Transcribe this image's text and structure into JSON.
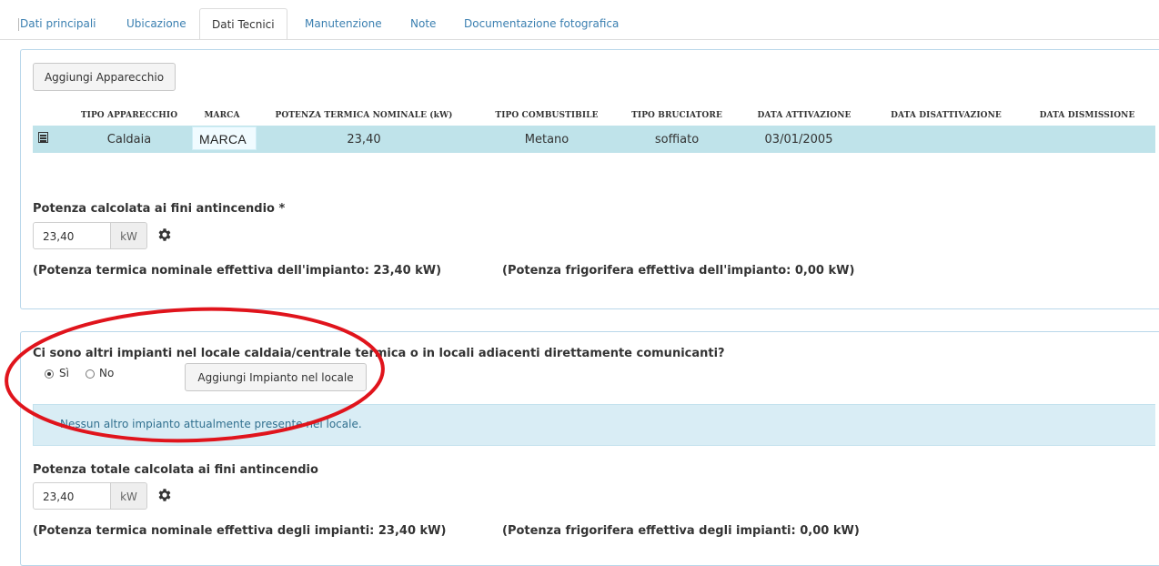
{
  "tabs": [
    {
      "label": "Dati principali"
    },
    {
      "label": "Ubicazione"
    },
    {
      "label": "Dati Tecnici"
    },
    {
      "label": "Manutenzione"
    },
    {
      "label": "Note"
    },
    {
      "label": "Documentazione fotografica"
    }
  ],
  "active_tab": "Dati Tecnici",
  "apparecchi": {
    "add_button": "Aggiungi Apparecchio",
    "columns": [
      "TIPO APPARECCHIO",
      "MARCA",
      "POTENZA TERMICA NOMINALE (kW)",
      "TIPO COMBUSTIBILE",
      "TIPO BRUCIATORE",
      "DATA ATTIVAZIONE",
      "DATA DISATTIVAZIONE",
      "DATA DISMISSIONE"
    ],
    "rows": [
      {
        "tipo_apparecchio": "Caldaia",
        "marca": "MARCA",
        "potenza": "23,40",
        "tipo_combustibile": "Metano",
        "tipo_bruciatore": "soffiato",
        "data_attivazione": "03/01/2005",
        "data_disattivazione": "",
        "data_dismissione": ""
      }
    ],
    "row_icon": "list-icon"
  },
  "potenza_antincendio": {
    "label": "Potenza calcolata ai fini antincendio *",
    "value": "23,40",
    "unit": "kW",
    "gear_icon": "gear-icon",
    "note_termica": "(Potenza termica nominale effettiva dell'impianto: 23,40 kW)",
    "note_frigorifera": "(Potenza frigorifera effettiva dell'impianto: 0,00 kW)"
  },
  "altri_impianti": {
    "question": "Ci sono altri impianti nel locale caldaia/centrale termica o in locali adiacenti direttamente comunicanti?",
    "options": [
      {
        "label": "Sì",
        "selected": true
      },
      {
        "label": "No",
        "selected": false
      }
    ],
    "add_button": "Aggiungi Impianto nel locale",
    "info_message": "Nessun altro impianto attualmente presente nel locale."
  },
  "potenza_totale": {
    "label": "Potenza totale calcolata ai fini antincendio",
    "value": "23,40",
    "unit": "kW",
    "gear_icon": "gear-icon",
    "note_termica": "(Potenza termica nominale effettiva degli impianti: 23,40 kW)",
    "note_frigorifera": "(Potenza frigorifera effettiva degli impianti: 0,00 kW)"
  },
  "colors": {
    "link": "#3a7fb0",
    "selected_row": "#bfe3ea",
    "info_bg": "#d9edf5",
    "info_text": "#31708f",
    "panel_border": "#b9d7ea",
    "annotation_ellipse": "#e0141c"
  }
}
